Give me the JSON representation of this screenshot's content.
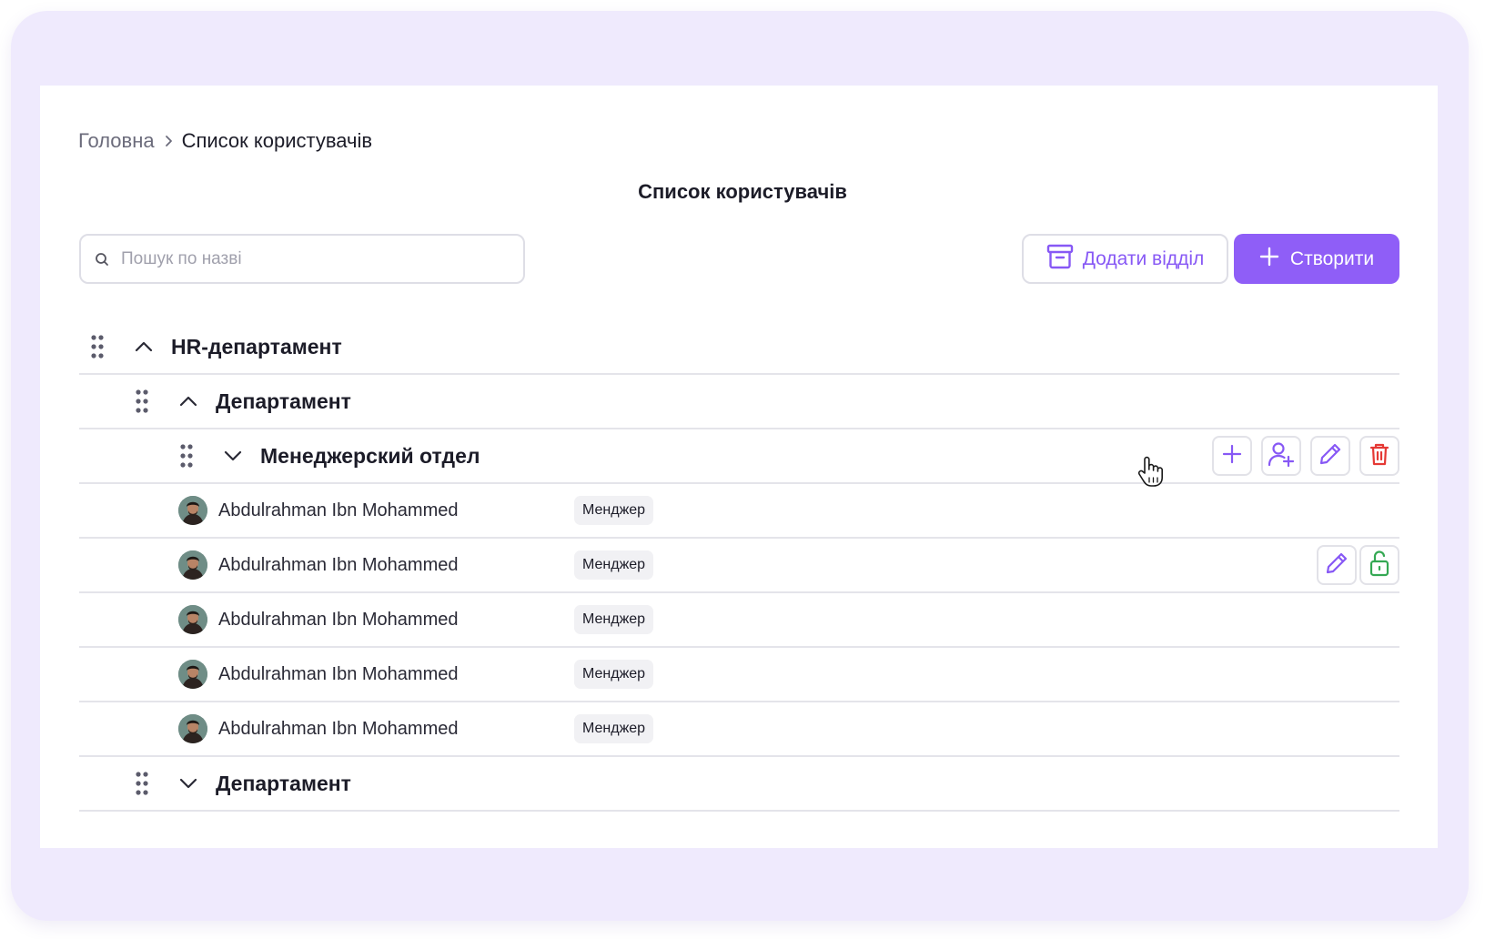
{
  "breadcrumb": {
    "home": "Головна",
    "separator_icon": "chevron-right-icon",
    "current": "Список користувачів"
  },
  "page": {
    "title": "Список користувачів"
  },
  "search": {
    "placeholder": "Пошук по назві",
    "value": "",
    "icon": "search-icon"
  },
  "toolbar": {
    "add_department_label": "Додати відділ",
    "add_department_icon": "archive-icon",
    "create_label": "Створити",
    "create_icon": "plus-icon"
  },
  "colors": {
    "accent": "#8f5ef7",
    "accent_text": "#8758f5",
    "danger": "#e53935",
    "success": "#34a853",
    "frame_bg": "#efeafd"
  },
  "tree": {
    "hr": {
      "label": "HR-департамент",
      "expanded": true
    },
    "dept1": {
      "label": "Департамент",
      "expanded": true
    },
    "managers": {
      "label": "Менеджерский отдел",
      "expanded": false,
      "actions": [
        "plus-icon",
        "add-user-icon",
        "pencil-icon",
        "trash-icon"
      ]
    },
    "users": [
      {
        "name": "Abdulrahman Ibn Mohammed",
        "role": "Менджер"
      },
      {
        "name": "Abdulrahman Ibn Mohammed",
        "role": "Менджер",
        "actions": [
          "pencil-icon",
          "unlock-icon"
        ]
      },
      {
        "name": "Abdulrahman Ibn Mohammed",
        "role": "Менджер"
      },
      {
        "name": "Abdulrahman Ibn Mohammed",
        "role": "Менджер"
      },
      {
        "name": "Abdulrahman Ibn Mohammed",
        "role": "Менджер"
      }
    ],
    "dept2": {
      "label": "Департамент",
      "expanded": false
    }
  }
}
